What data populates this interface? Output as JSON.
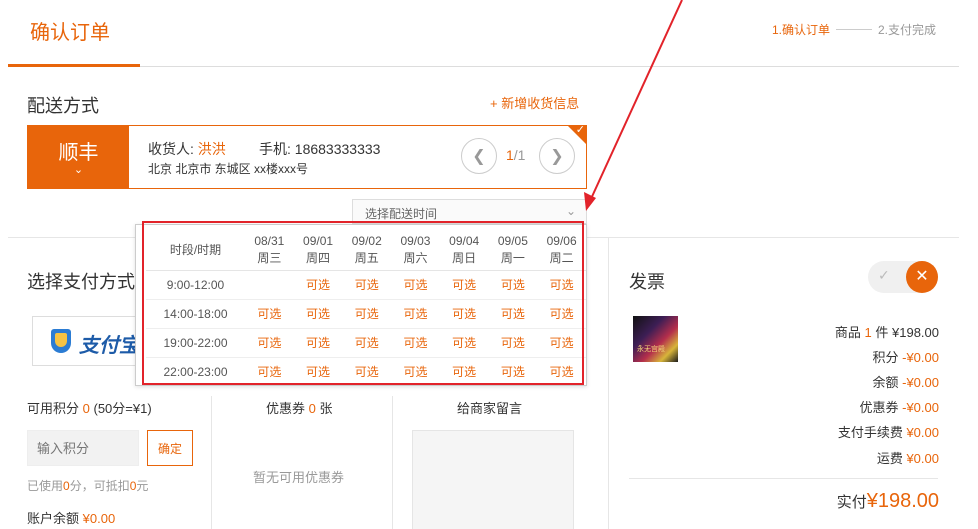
{
  "header": {
    "title": "确认订单",
    "steps": [
      "1.确认订单",
      "2.支付完成"
    ]
  },
  "delivery": {
    "title": "配送方式",
    "add_address": "+ 新增收货信息",
    "carrier": "顺丰",
    "recipient_label": "收货人:",
    "recipient_name": "洪洪",
    "phone_label": "手机:",
    "phone": "18683333333",
    "address": "北京 北京市 东城区 xx楼xxx号",
    "page_current": "1",
    "page_total": "/1",
    "time_placeholder": "选择配送时间"
  },
  "time_table": {
    "corner_header": "时段/时期",
    "days": [
      {
        "date": "08/31",
        "weekday": "周三"
      },
      {
        "date": "09/01",
        "weekday": "周四"
      },
      {
        "date": "09/02",
        "weekday": "周五"
      },
      {
        "date": "09/03",
        "weekday": "周六"
      },
      {
        "date": "09/04",
        "weekday": "周日"
      },
      {
        "date": "09/05",
        "weekday": "周一"
      },
      {
        "date": "09/06",
        "weekday": "周二"
      }
    ],
    "rows": [
      {
        "slot": "9:00-12:00",
        "cells": [
          "",
          "可选",
          "可选",
          "可选",
          "可选",
          "可选",
          "可选"
        ]
      },
      {
        "slot": "14:00-18:00",
        "cells": [
          "可选",
          "可选",
          "可选",
          "可选",
          "可选",
          "可选",
          "可选"
        ]
      },
      {
        "slot": "19:00-22:00",
        "cells": [
          "可选",
          "可选",
          "可选",
          "可选",
          "可选",
          "可选",
          "可选"
        ]
      },
      {
        "slot": "22:00-23:00",
        "cells": [
          "可选",
          "可选",
          "可选",
          "可选",
          "可选",
          "可选",
          "可选"
        ]
      }
    ]
  },
  "payment": {
    "title": "选择支付方式",
    "alipay_text": "支付宝"
  },
  "points": {
    "label": "可用积分",
    "value": "0",
    "rule": "(50分=¥1)",
    "input_placeholder": "输入积分",
    "confirm": "确定",
    "used_prefix": "已使用",
    "used_value": "0",
    "used_mid": "分，可抵扣",
    "deduct_value": "0",
    "used_suffix": "元",
    "balance_label": "账户余额",
    "balance_value": "¥0.00"
  },
  "coupon": {
    "label": "优惠券",
    "count": "0",
    "unit": "张",
    "empty": "暂无可用优惠券"
  },
  "message": {
    "title": "给商家留言"
  },
  "invoice": {
    "title": "发票",
    "thumb_text": "永无宫殿"
  },
  "summary": {
    "goods_label": "商品",
    "goods_count": "1",
    "goods_unit": "件",
    "goods_price": "¥198.00",
    "points_label": "积分",
    "points_value": "-¥0.00",
    "balance_label": "余额",
    "balance_value": "-¥0.00",
    "coupon_label": "优惠券",
    "coupon_value": "-¥0.00",
    "fee_label": "支付手续费",
    "fee_value": "¥0.00",
    "shipping_label": "运费",
    "shipping_value": "¥0.00",
    "total_label": "实付",
    "total_value": "¥198.00"
  },
  "colors": {
    "accent": "#e8650b",
    "annotation_red": "#e2232a"
  }
}
